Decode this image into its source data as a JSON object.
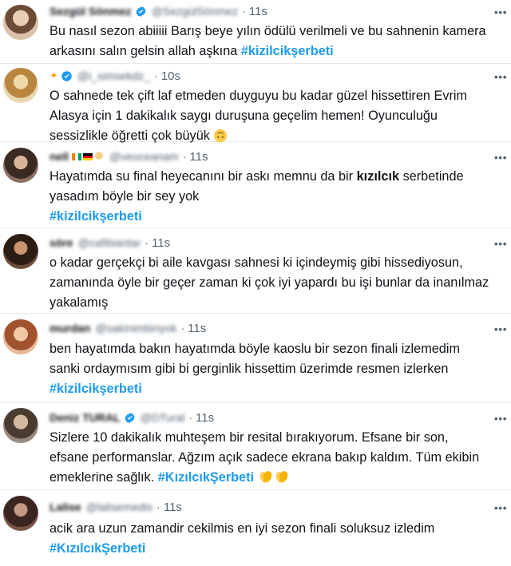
{
  "tweets": [
    {
      "name": "Sezgül Sönmez",
      "handle": "@SezgülSönmez",
      "time": "11s",
      "lines": [
        "Bu nasıl sezon abiiiii Barış beye yılın ödülü verilmeli ve bu sahnenin kamera",
        "arkasını salın gelsin allah aşkına"
      ],
      "hashtag": "#kizilcikşerbeti"
    },
    {
      "handle": "@i_simsekdz_",
      "time": "10s",
      "lines": [
        "O sahnede tek çift laf etmeden duyguyu bu kadar güzel hissettiren Evrim",
        "Alasya için 1 dakikalık saygı duruşuna geçelim hemen! Oyunculuğu",
        "sessizlikle öğretti çok büyük"
      ]
    },
    {
      "name": "nell",
      "handle": "@veoceanam",
      "time": "11s",
      "lines": [
        "Hayatımda su final heyecanını bir askı memnu da bir",
        "serbetinde",
        "yasadım böyle bir sey yok"
      ],
      "bold_word": "kızılcık",
      "hashtag": "#kizilcikşerbeti"
    },
    {
      "name": "söre",
      "handle": "@cafibiantar",
      "time": "11s",
      "lines": [
        "o kadar gerçekçi bi aile kavgası sahnesi ki içindeymiş gibi hissediyosun,",
        "zamanında öyle bir geçer zaman ki çok iyi yapardı bu işi  bunlar da inanılmaz",
        "yakalamış"
      ]
    },
    {
      "name": "murdan",
      "handle": "@sakinimbiriyok",
      "time": "11s",
      "lines": [
        "ben hayatımda bakın hayatımda böyle kaoslu bir sezon finali izlemedim",
        "sanki ordaymısım gibi bi gerginlik hissettim üzerimde resmen izlerken"
      ],
      "hashtag": "#kizilcikşerbeti"
    },
    {
      "name": "Deniz TURAL",
      "handle": "@DTural",
      "time": "11s",
      "lines": [
        "Sizlere 10 dakikalık muhteşem bir resital bırakıyorum. Efsane bir son,",
        "efsane performanslar. Ağzım açık sadece ekrana bakıp kaldım. Tüm ekibin",
        "emeklerine sağlık."
      ],
      "hashtag": "#KızılcıkŞerbeti"
    },
    {
      "name": "Lalise",
      "handle": "@lalisemedis",
      "time": "11s",
      "lines": [
        "acik ara uzun zamandir cekilmis en iyi sezon finali soluksuz izledim"
      ],
      "hashtag": "#KızılcıkŞerbeti"
    }
  ],
  "icons": {
    "verified": "verified-badge-icon",
    "more": "more-options-icon",
    "emoji_1": "upside-down-face-emoji",
    "emoji_2": "clapping-hands-emoji"
  },
  "colors": {
    "hashtag": "#1d9bf0",
    "text": "#0f1419",
    "secondary": "#536471",
    "divider": "#e7e9ea",
    "verified": "#1d9bf0"
  }
}
